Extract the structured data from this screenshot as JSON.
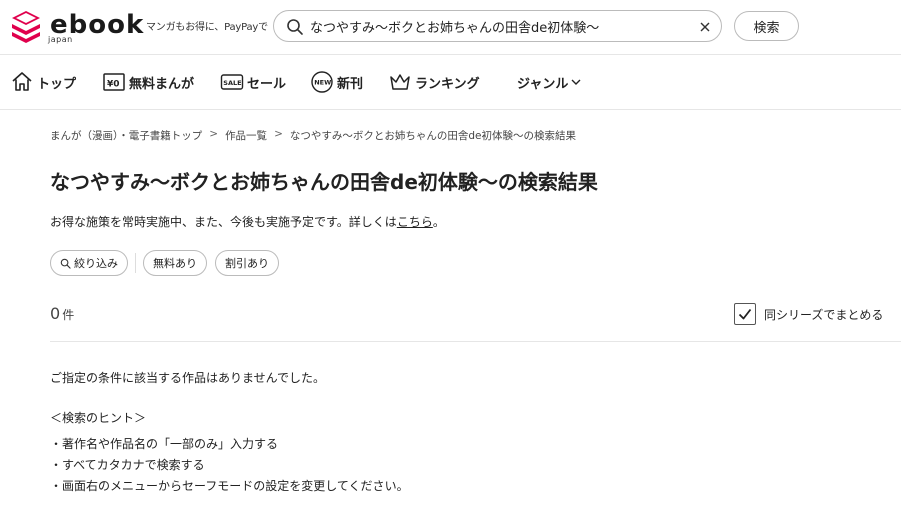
{
  "header": {
    "logo_text": "ebook",
    "logo_sub": "japan",
    "tagline": "マンガもお得に、PayPayで",
    "search": {
      "value": "なつやすみ～ボクとお姉ちゃんの田舎de初体験～",
      "button_label": "検索"
    }
  },
  "nav": {
    "items": [
      {
        "label": "トップ",
        "icon": "home-icon"
      },
      {
        "label": "無料まんが",
        "icon": "free-yen-icon"
      },
      {
        "label": "セール",
        "icon": "sale-tag-icon"
      },
      {
        "label": "新刊",
        "icon": "new-badge-icon"
      },
      {
        "label": "ランキング",
        "icon": "crown-icon"
      },
      {
        "label": "ジャンル",
        "icon": "chevron-down-icon"
      }
    ]
  },
  "breadcrumb": {
    "items": [
      "まんが（漫画）・電子書籍トップ",
      "作品一覧",
      "なつやすみ～ボクとお姉ちゃんの田舎de初体験～の検索結果"
    ],
    "separator": ">"
  },
  "title": {
    "query": "なつやすみ～ボクとお姉ちゃんの田舎de初体験～",
    "suffix": "の検索結果"
  },
  "notice": {
    "text": "お得な施策を常時実施中、また、今後も実施予定です。詳しくは",
    "link": "こちら",
    "end": "。"
  },
  "filters": {
    "refine": "絞り込み",
    "free": "無料あり",
    "discount": "割引あり"
  },
  "results": {
    "count": "0",
    "unit": "件",
    "series_label": "同シリーズでまとめる",
    "series_checked": true
  },
  "empty": {
    "message": "ご指定の条件に該当する作品はありませんでした。",
    "hint_title": "＜検索のヒント＞",
    "hints": [
      "・著作名や作品名の「一部のみ」入力する",
      "・すべてカタカナで検索する",
      "・画面右のメニューからセーフモードの設定を変更してください。"
    ]
  },
  "colors": {
    "brand": "#e0004d",
    "text": "#222222",
    "border": "#bbbbbb"
  }
}
